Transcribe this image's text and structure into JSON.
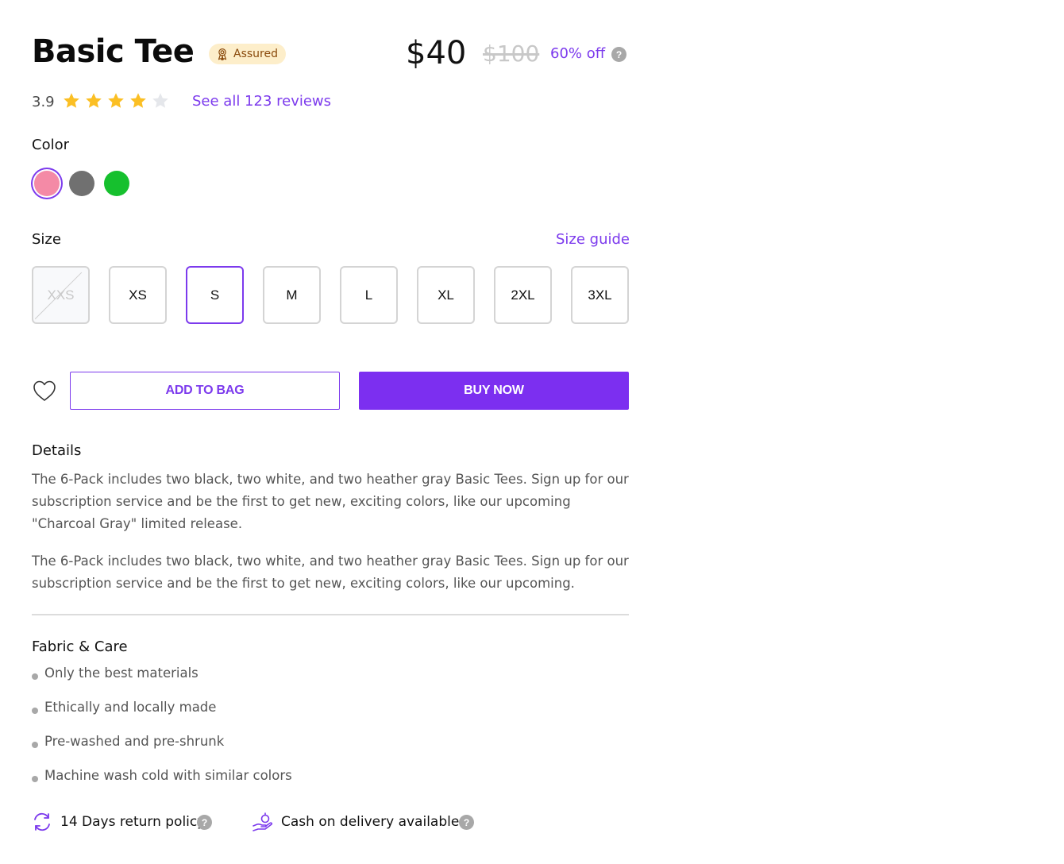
{
  "product": {
    "title": "Basic Tee",
    "assured_label": "Assured",
    "price": "$40",
    "original_price": "$100",
    "discount": "60% off",
    "help_glyph": "?"
  },
  "rating": {
    "value": "3.9",
    "stars_filled": 4,
    "stars_total": 5,
    "reviews_link": "See all 123 reviews"
  },
  "color": {
    "label": "Color",
    "options": [
      {
        "name": "pink",
        "hex": "#f48aa6",
        "selected": true
      },
      {
        "name": "gray",
        "hex": "#707070",
        "selected": false
      },
      {
        "name": "green",
        "hex": "#16c02e",
        "selected": false
      }
    ]
  },
  "size": {
    "label": "Size",
    "guide_link": "Size guide",
    "options": [
      {
        "label": "XXS",
        "state": "disabled"
      },
      {
        "label": "XS",
        "state": "available"
      },
      {
        "label": "S",
        "state": "selected"
      },
      {
        "label": "M",
        "state": "available"
      },
      {
        "label": "L",
        "state": "available"
      },
      {
        "label": "XL",
        "state": "available"
      },
      {
        "label": "2XL",
        "state": "available"
      },
      {
        "label": "3XL",
        "state": "available"
      }
    ]
  },
  "actions": {
    "wishlist_icon": "heart-icon",
    "add_to_bag": "ADD TO BAG",
    "buy_now": "BUY NOW"
  },
  "details": {
    "heading": "Details",
    "paragraphs": [
      "The 6-Pack includes two black, two white, and two heather gray Basic Tees. Sign up for our subscription service and be the first to get new, exciting colors, like our upcoming \"Charcoal Gray\" limited release.",
      "The 6-Pack includes two black, two white, and two heather gray Basic Tees. Sign up for our subscription service and be the first to get new, exciting colors, like our upcoming."
    ]
  },
  "fabric": {
    "heading": "Fabric & Care",
    "items": [
      "Only the best materials",
      "Ethically and locally made",
      "Pre-washed and pre-shrunk",
      "Machine wash cold with similar colors"
    ]
  },
  "policies": {
    "return": {
      "label": "14 Days return policy",
      "icon": "return-arrows-icon"
    },
    "cod": {
      "label": "Cash on delivery available",
      "icon": "cash-hand-icon"
    }
  },
  "colors": {
    "accent": "#7c3aed",
    "star": "#fbbf24",
    "star_empty": "#e5e7eb",
    "assured_bg": "#fdeeca"
  }
}
